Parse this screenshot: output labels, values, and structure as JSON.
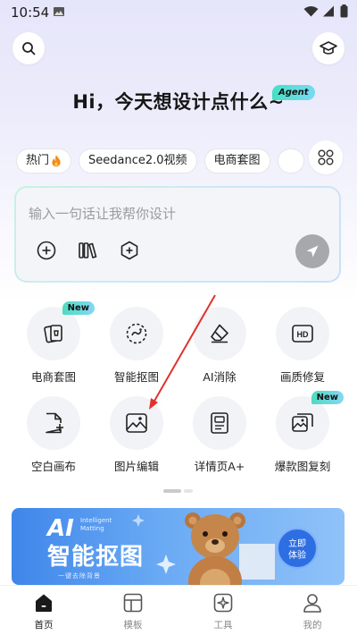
{
  "status_bar": {
    "time": "10:54"
  },
  "greeting": {
    "text": "Hi，今天想设计点什么~",
    "badge": "Agent"
  },
  "chips": [
    {
      "label": "热门",
      "icon": "fire-icon"
    },
    {
      "label": "Seedance2.0视频"
    },
    {
      "label": "电商套图"
    },
    {
      "label": ""
    }
  ],
  "input": {
    "placeholder": "输入一句话让我帮你设计",
    "tools": [
      "add-icon",
      "library-icon",
      "hexagon-plus-icon"
    ],
    "send_icon": "send-icon"
  },
  "features": [
    {
      "label": "电商套图",
      "badge": "New",
      "icon": "shopping-cards-icon"
    },
    {
      "label": "智能抠图",
      "icon": "smart-cutout-icon"
    },
    {
      "label": "AI消除",
      "icon": "eraser-icon"
    },
    {
      "label": "画质修复",
      "icon": "hd-icon"
    },
    {
      "label": "空白画布",
      "icon": "blank-canvas-icon"
    },
    {
      "label": "图片编辑",
      "icon": "image-edit-icon"
    },
    {
      "label": "详情页A+",
      "icon": "detail-page-icon"
    },
    {
      "label": "爆款图复刻",
      "badge": "New",
      "icon": "replicate-image-icon"
    }
  ],
  "banner": {
    "ai": "AI",
    "en": "Intelligent Matting",
    "title": "智能抠图",
    "subtitle": "一键去除背景",
    "cta_line1": "立即",
    "cta_line2": "体验"
  },
  "bottom_nav": [
    {
      "label": "首页",
      "active": true,
      "icon": "home-icon"
    },
    {
      "label": "模板",
      "icon": "template-icon"
    },
    {
      "label": "工具",
      "icon": "tools-icon"
    },
    {
      "label": "我的",
      "icon": "profile-icon"
    }
  ],
  "colors": {
    "accent_gradient_start": "#4fdbc0",
    "accent_gradient_end": "#84d7f3",
    "banner_blue": "#3f86ea",
    "send_button": "#a7a8ac",
    "annotation_red": "#e0322f"
  }
}
